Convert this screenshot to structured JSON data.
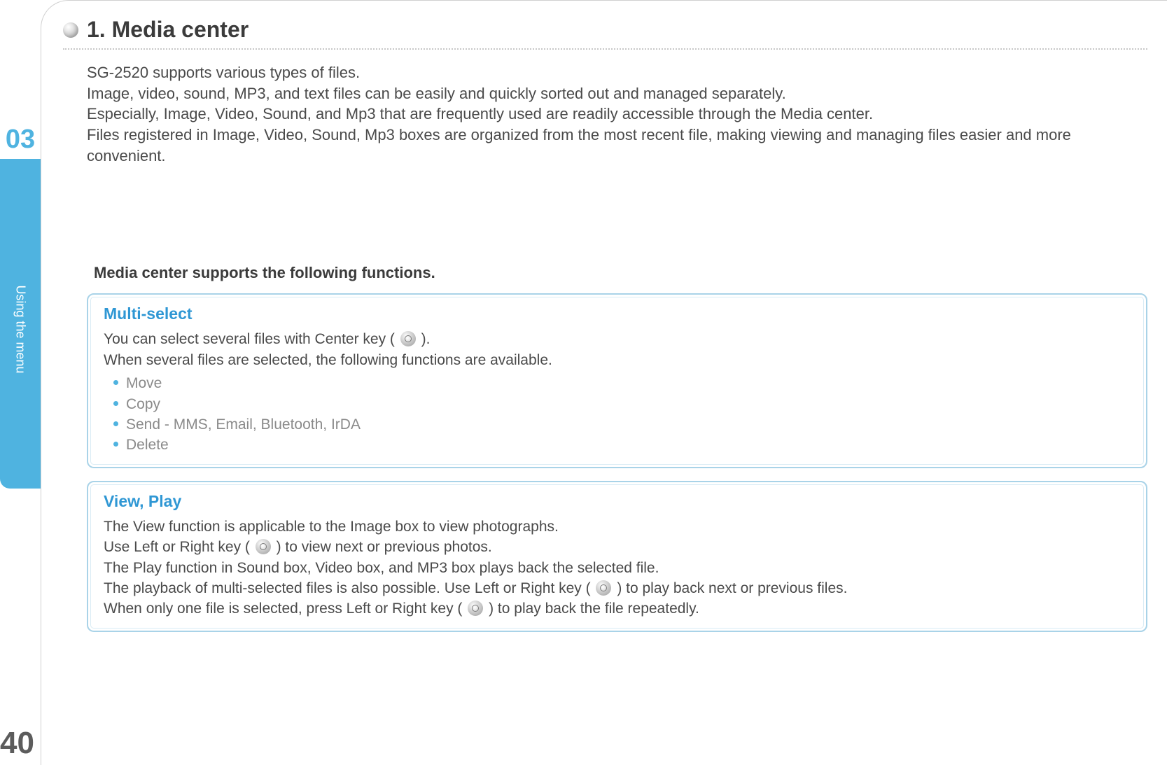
{
  "chapter": {
    "number": "03",
    "side_label": "Using the menu"
  },
  "page_number": "40",
  "heading": "1. Media center",
  "intro": {
    "p1": "SG-2520 supports various types of files.",
    "p2": "Image, video, sound, MP3, and text files can be easily and quickly sorted out and managed separately.",
    "p3": "Especially, Image, Video, Sound, and Mp3 that are frequently used are readily accessible through the Media center.",
    "p4": "Files registered in Image, Video, Sound, Mp3 boxes are organized from the most recent file, making viewing and managing files easier and more convenient."
  },
  "subheading": "Media center supports the following functions.",
  "box1": {
    "title": "Multi-select",
    "line1a": "You can select several files with Center key ( ",
    "line1b": " ).",
    "line2": "When several files are selected, the following functions are available.",
    "bullets": [
      "Move",
      "Copy",
      "Send - MMS, Email, Bluetooth, IrDA",
      "Delete"
    ]
  },
  "box2": {
    "title": "View, Play",
    "line1": "The View function is applicable to the Image box to view photographs.",
    "line2a": "Use Left or Right key ( ",
    "line2b": " ) to view next or previous photos.",
    "line3": "The Play function in Sound box, Video box, and MP3 box plays back the selected file.",
    "line4a": "The playback of multi-selected files is also possible. Use Left or Right key ( ",
    "line4b": " ) to play back next or previous files.",
    "line5a": "When only one file is selected, press  Left or Right key ( ",
    "line5b": " ) to play back the file repeatedly."
  }
}
